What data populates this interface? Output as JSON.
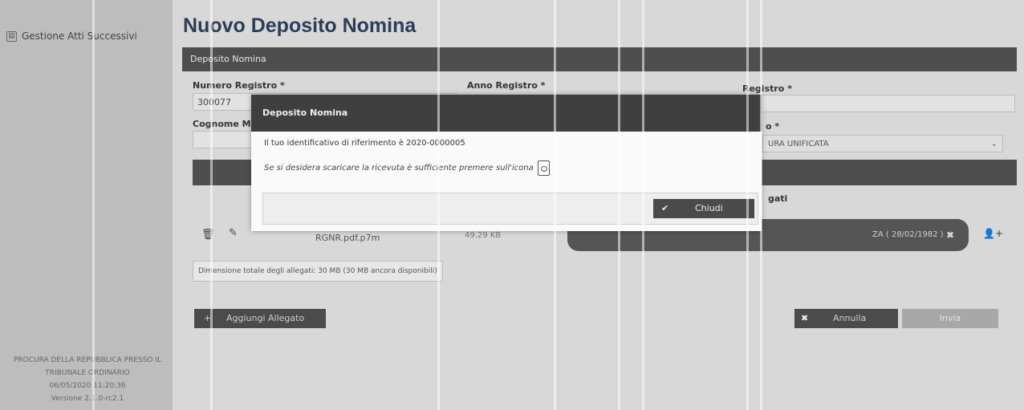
{
  "sidebar": {
    "menu_item": "Gestione Atti Successivi",
    "footer": {
      "line1": "PROCURA DELLA REPUBBLICA PRESSO IL",
      "line2": "TRIBUNALE ORDINARIO",
      "line3": "06/05/2020 11:20:36",
      "line4": "Versione 2.1.0-rc2.1"
    }
  },
  "main": {
    "title": "Nuovo Deposito Nomina",
    "section_label": "Deposito Nomina",
    "fields": {
      "numero_registro_label": "Numero Registro *",
      "numero_registro_value": "300077",
      "anno_registro_label": "Anno Registro *",
      "registro_label": "Registro *",
      "cognome_label": "Cognome Mag",
      "tipo_label": "o *",
      "tipo_value": "URA UNIFICATA"
    },
    "allegati_label": "gati",
    "file_name": "RGNR.pdf.p7m",
    "file_size": "49.29 KB",
    "chip_text": "ZA ( 28/02/1982 )",
    "note": "Dimensione totale degli allegati: 30 MB (30 MB ancora disponibili)",
    "buttons": {
      "aggiungi": "Aggiungi Allegato",
      "annulla": "Annulla",
      "invia": "Invia"
    }
  },
  "modal": {
    "title": "Deposito Nomina",
    "line1": "Il tuo identificativo di riferimento è 2020-0000005",
    "line2": "Se si desidera scaricare la ricevuta è sufficiente premere sull'icona",
    "close_label": "Chiudi"
  }
}
